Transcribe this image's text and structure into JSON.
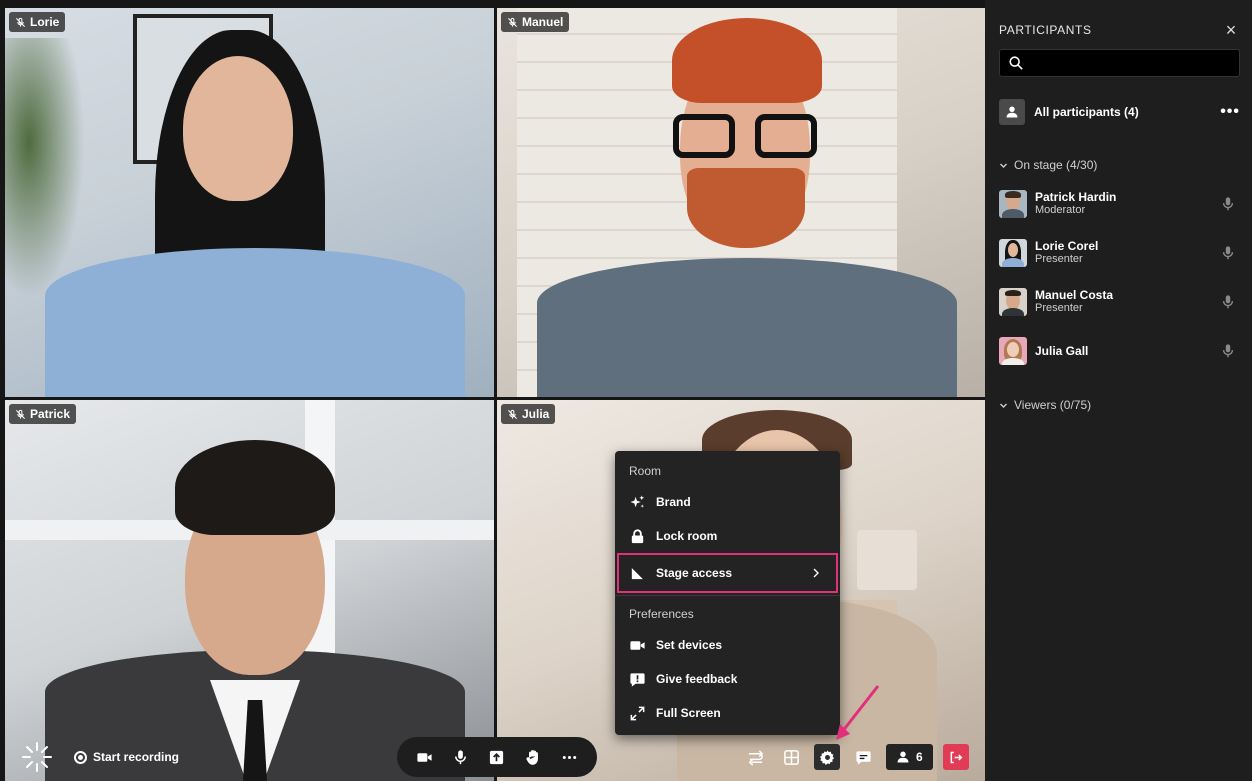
{
  "tiles": [
    {
      "name": "Lorie"
    },
    {
      "name": "Manuel"
    },
    {
      "name": "Patrick"
    },
    {
      "name": "Julia"
    }
  ],
  "menu": {
    "section_room": "Room",
    "brand": "Brand",
    "lock_room": "Lock room",
    "stage_access": "Stage access",
    "section_preferences": "Preferences",
    "set_devices": "Set devices",
    "give_feedback": "Give feedback",
    "full_screen": "Full Screen"
  },
  "toolbar": {
    "start_recording": "Start recording",
    "participants_count": "6"
  },
  "sidebar": {
    "title": "PARTICIPANTS",
    "close_glyph": "×",
    "search_placeholder": "",
    "all_participants": "All participants (4)",
    "more_glyph": "•••",
    "on_stage": "On stage (4/30)",
    "viewers": "Viewers (0/75)",
    "participants": [
      {
        "name": "Patrick Hardin",
        "role": "Moderator"
      },
      {
        "name": "Lorie Corel",
        "role": "Presenter"
      },
      {
        "name": "Manuel Costa",
        "role": "Presenter"
      },
      {
        "name": "Julia Gall",
        "role": ""
      }
    ]
  },
  "colors": {
    "accent_highlight": "#e0307a",
    "leave_button": "#e23b55",
    "panel_bg": "#1e1e1e"
  }
}
